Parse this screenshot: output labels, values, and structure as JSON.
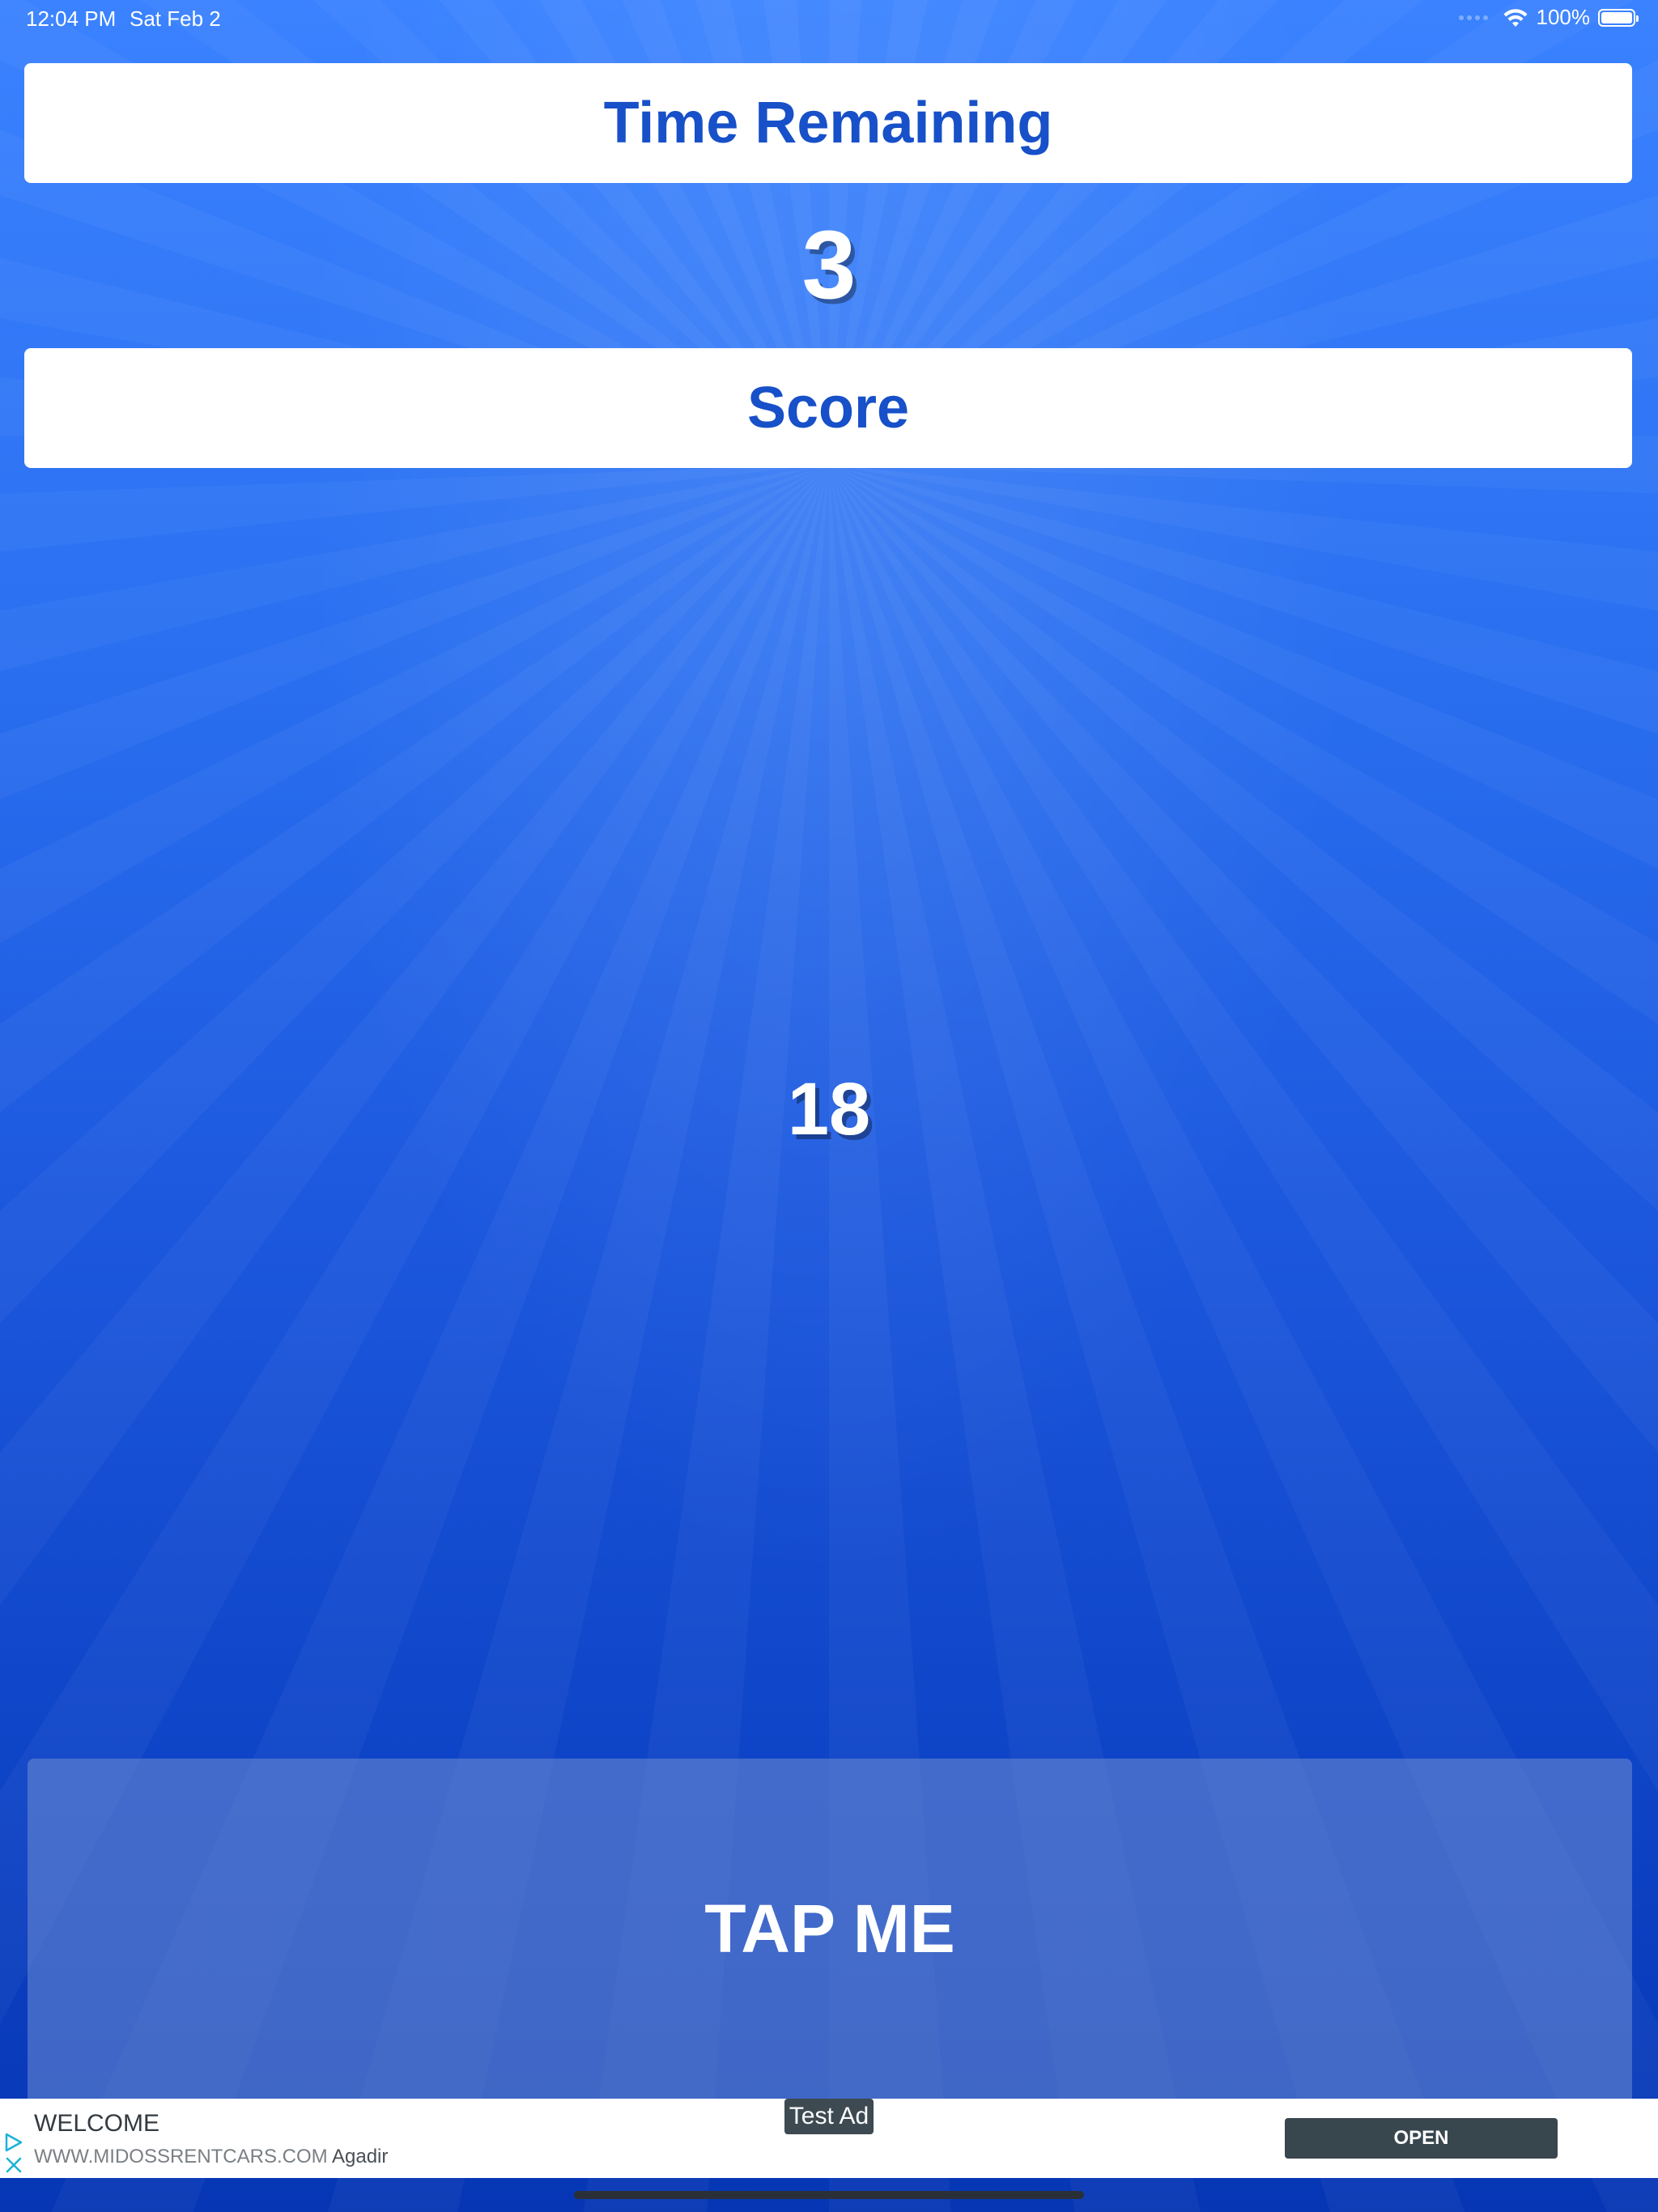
{
  "status_bar": {
    "time": "12:04 PM",
    "date": "Sat Feb 2",
    "battery": "100%",
    "battery_level": 1.0,
    "wifi_icon": "wifi-icon",
    "battery_icon": "battery-icon"
  },
  "game": {
    "time_label": "Time Remaining",
    "time_value": "3",
    "score_label": "Score",
    "score_value": "18",
    "tap_button_label": "TAP ME"
  },
  "ad": {
    "label": "Test Ad",
    "title": "WELCOME",
    "url": "WWW.MIDOSSRENTCARS.COM",
    "city": "Agadir",
    "open_label": "OPEN",
    "choices_icon": "ad-choices-icon",
    "close_icon": "close-icon"
  },
  "colors": {
    "background_top": "#3a82ff",
    "background_bottom": "#0636b4",
    "panel_text": "#1750c8",
    "ad_button": "#38464e"
  }
}
